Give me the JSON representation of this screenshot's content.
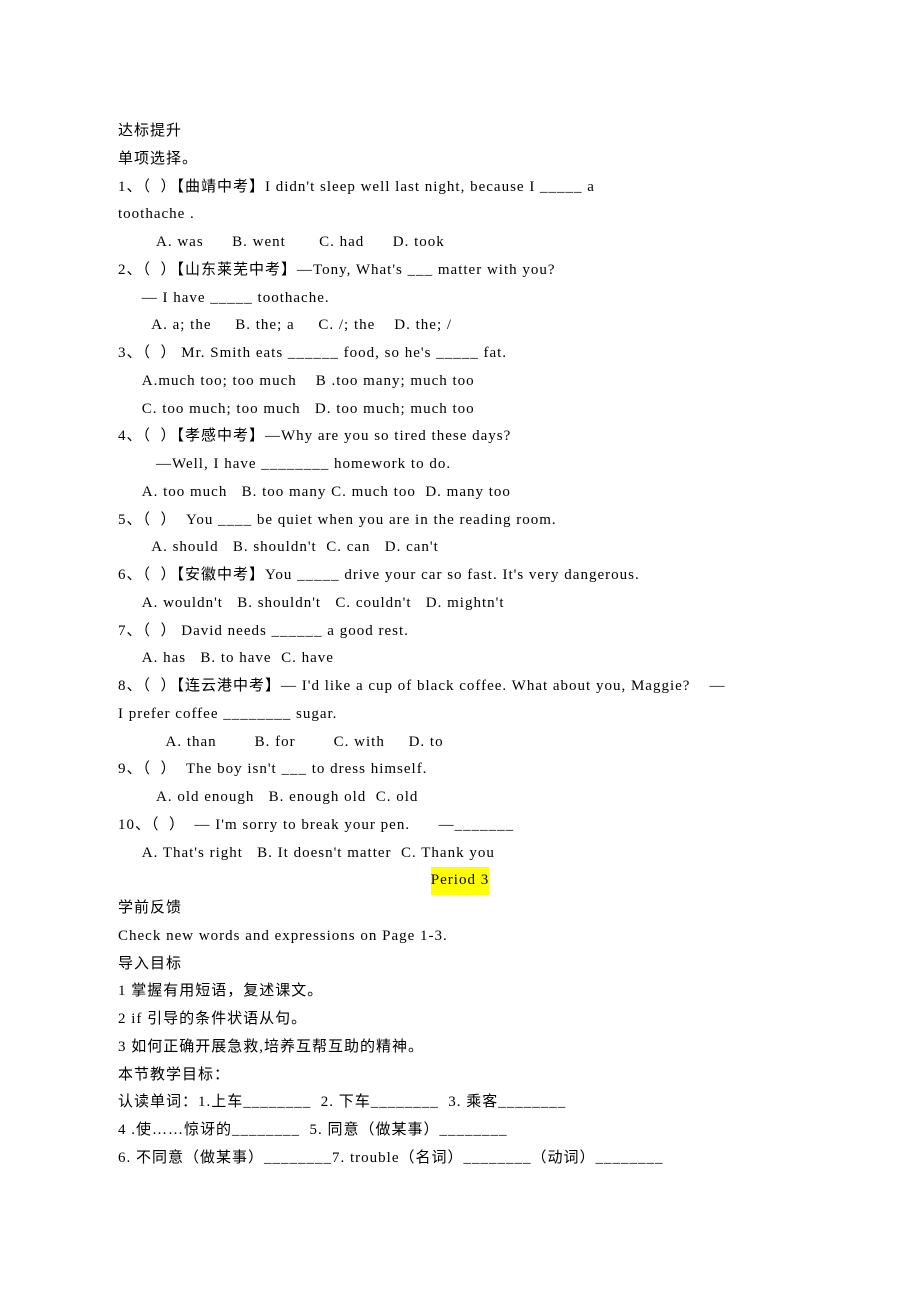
{
  "header": {
    "title1": "达标提升",
    "title2": "单项选择。"
  },
  "questions": [
    {
      "stem_lines": [
        "1、（  ）【曲靖中考】I didn't sleep well last night, because I _____ a",
        "toothache ."
      ],
      "options": "        A. was      B. went       C. had      D. took"
    },
    {
      "stem_lines": [
        "2、（  ）【山东莱芜中考】—Tony, What's ___ matter with you?",
        "     — I have _____ toothache."
      ],
      "options": "       A. a; the     B. the; a     C. /; the    D. the; /"
    },
    {
      "stem_lines": [
        "3、（  ） Mr. Smith eats ______ food, so he's _____ fat."
      ],
      "options": "     A.much too; too much    B .too many; much too\n     C. too much; too much   D. too much; much too"
    },
    {
      "stem_lines": [
        "4、（  ）【孝感中考】—Why are you so tired these days?",
        "        —Well, I have ________ homework to do."
      ],
      "options": "     A. too much   B. too many C. much too  D. many too"
    },
    {
      "stem_lines": [
        "5、（  ）  You ____ be quiet when you are in the reading room."
      ],
      "options": "       A. should   B. shouldn't  C. can   D. can't"
    },
    {
      "stem_lines": [
        "6、（  ）【安徽中考】You _____ drive your car so fast. It's very dangerous."
      ],
      "options": "     A. wouldn't   B. shouldn't   C. couldn't   D. mightn't"
    },
    {
      "stem_lines": [
        "7、（  ） David needs ______ a good rest."
      ],
      "options": "     A. has   B. to have  C. have"
    },
    {
      "stem_lines": [
        "8、（  ）【连云港中考】— I'd like a cup of black coffee. What about you, Maggie?    —",
        "I prefer coffee ________ sugar."
      ],
      "options": "          A. than        B. for        C. with     D. to"
    },
    {
      "stem_lines": [
        "9、（  ）  The boy isn't ___ to dress himself."
      ],
      "options": "        A. old enough   B. enough old  C. old"
    },
    {
      "stem_lines": [
        "10、（  ）  — I'm sorry to break your pen.      —_______"
      ],
      "options": "     A. That's right   B. It doesn't matter  C. Thank you"
    }
  ],
  "period": {
    "label": "Period 3"
  },
  "section2": {
    "heading1": "学前反馈",
    "line1": "Check new words and expressions on Page 1-3.",
    "heading2": "导入目标",
    "goals": [
      "1 掌握有用短语，复述课文。",
      "2 if 引导的条件状语从句。",
      "3 如何正确开展急救,培养互帮互助的精神。"
    ],
    "heading3": "本节教学目标：",
    "vocab": [
      "认读单词：1.上车________  2. 下车________  3. 乘客________",
      "4 .使……惊讶的________  5. 同意（做某事）________",
      "6. 不同意（做某事）________7. trouble（名词）________（动词）________"
    ]
  }
}
